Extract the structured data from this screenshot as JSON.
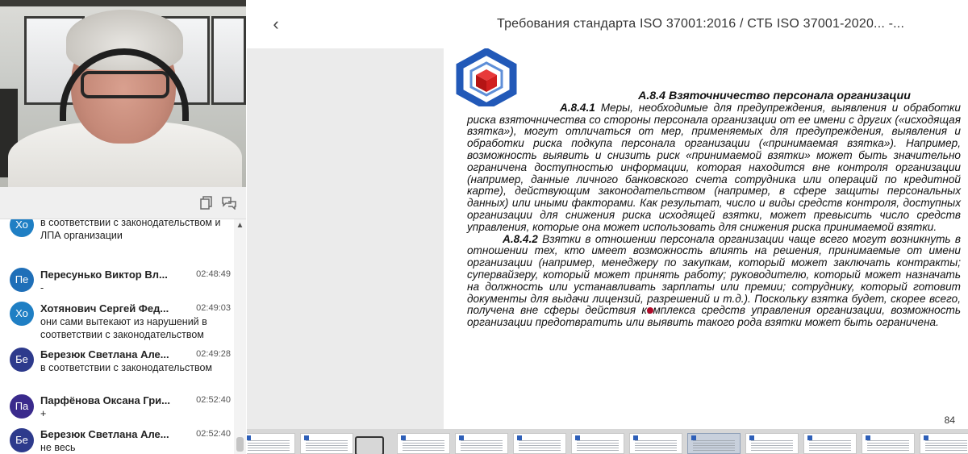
{
  "video": {
    "participant": "video-feed"
  },
  "toolbar": {
    "copy_icon": "copy-icon",
    "chat_icon": "chat-bubble-icon"
  },
  "chat": {
    "messages": [
      {
        "initials": "Хо",
        "color": "#1f7fc4",
        "name": "",
        "time": "",
        "text": "в соответствии с законодательством и ЛПА организации"
      },
      {
        "initials": "Пе",
        "color": "#1f6fb8",
        "name": "Пересунько Виктор Вл...",
        "time": "02:48:49",
        "text": "-"
      },
      {
        "initials": "Хо",
        "color": "#1f7fc4",
        "name": "Хотянович Сергей Фед...",
        "time": "02:49:03",
        "text": "они сами вытекают из нарушений в соответствии с законодательством"
      },
      {
        "initials": "Бе",
        "color": "#2d3a8c",
        "name": "Березюк Светлана Але...",
        "time": "02:49:28",
        "text": "в соответствии с законодательством"
      },
      {
        "initials": "Па",
        "color": "#3a2a8c",
        "name": "Парфёнова Оксана Гри...",
        "time": "02:52:40",
        "text": "+"
      },
      {
        "initials": "Бе",
        "color": "#2d3a8c",
        "name": "Березюк Светлана Але...",
        "time": "02:52:40",
        "text": "не весь"
      }
    ]
  },
  "header": {
    "back_label": "‹",
    "title": "Требования стандарта ISO 37001:2016 / СТБ ISO 37001-2020... -..."
  },
  "document": {
    "heading": "А.8.4 Взяточничество персонала организации",
    "p1_num": "А.8.4.1",
    "p1": " Меры, необходимые для предупреждения, выявления и обработки риска взяточничества со стороны персонала организации от ее имени с других («исходящая взятка»), могут отличаться от мер, применяемых для предупреждения, выявления и обработки риска подкупа персонала организации («принимаемая взятка»). Например, возможность выявить и снизить риск «принимаемой взятки» может быть значительно ограничена доступностью информации, которая находится вне контроля организации (например, данные личного банковского счета сотрудника или операций по кредитной карте), действующим законодательством (например, в сфере защиты персональных данных) или иными факторами. Как результат, число и виды средств контроля, доступных организации для снижения риска исходящей взятки, может превысить число средств управления, которые она может использовать для снижения риска принимаемой взятки.",
    "p2_num": "А.8.4.2",
    "p2": " Взятки в отношении персонала организации чаще всего могут возникнуть в отношении тех, кто имеет возможность влиять на решения, принимаемые от имени организации (например, менеджеру по закупкам, который может заключать контракты; супервайзеру, который может принять работу; руководителю, который может назначать на должность или устанавливать зарплаты или премии; сотруднику, который готовит документы для выдачи лицензий, разрешений и т.д.). Поскольку взятка будет, скорее всего, получена вне сферы действия комплекса средств управления организации, возможность организации предотвратить или выявить такого рода взятки может быть ограничена.",
    "page_number": "84"
  },
  "thumbnails": {
    "active_index": 8
  }
}
